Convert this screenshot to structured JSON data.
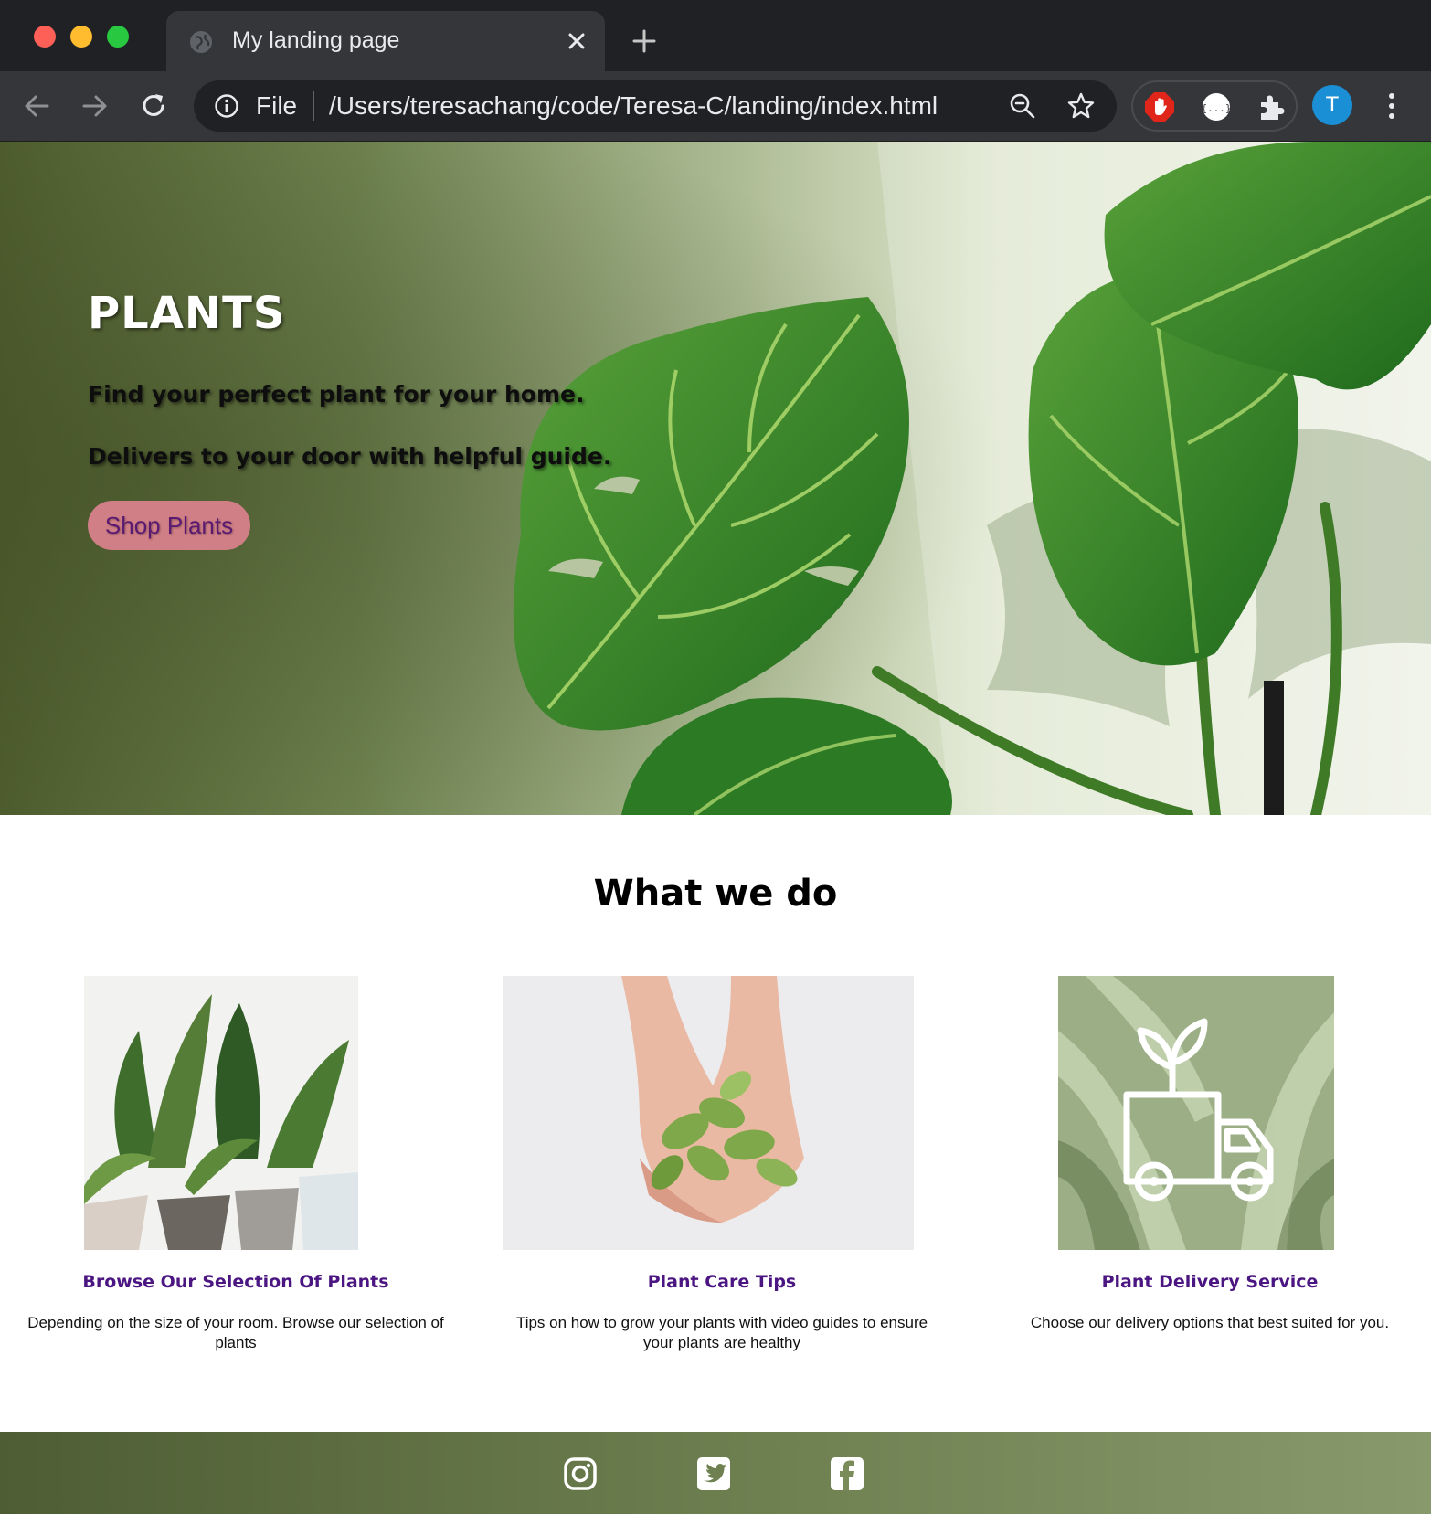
{
  "browser": {
    "tab_title": "My landing page",
    "omnibox_scheme": "File",
    "url": "/Users/teresachang/code/Teresa-C/landing/index.html",
    "avatar_letter": "T",
    "icons": [
      "globe-icon",
      "close-icon",
      "plus-icon",
      "back-icon",
      "forward-icon",
      "reload-icon",
      "info-icon",
      "zoom-icon",
      "star-icon",
      "adblock-extension-icon",
      "json-extension-icon",
      "puzzle-extension-icon",
      "kebab-menu-icon"
    ]
  },
  "hero": {
    "title": "PLANTS",
    "line1": "Find your perfect plant for your home.",
    "line2": "Delivers to your door with helpful guide.",
    "button_label": "Shop Plants"
  },
  "section": {
    "title": "What we do"
  },
  "cards": [
    {
      "title": "Browse Our Selection Of Plants",
      "text": "Depending on the size of your room. Browse our selection of plants"
    },
    {
      "title": "Plant Care Tips",
      "text": "Tips on how to grow your plants with video guides to ensure your plants are healthy"
    },
    {
      "title": "Plant Delivery Service",
      "text": "Choose our delivery options that best suited for you."
    }
  ],
  "footer": {
    "icons": [
      "instagram-icon",
      "twitter-icon",
      "facebook-icon"
    ]
  },
  "colors": {
    "accent_purple": "#4b1682",
    "button_pink": "#d17f86",
    "footer_green": "#6f8151"
  }
}
